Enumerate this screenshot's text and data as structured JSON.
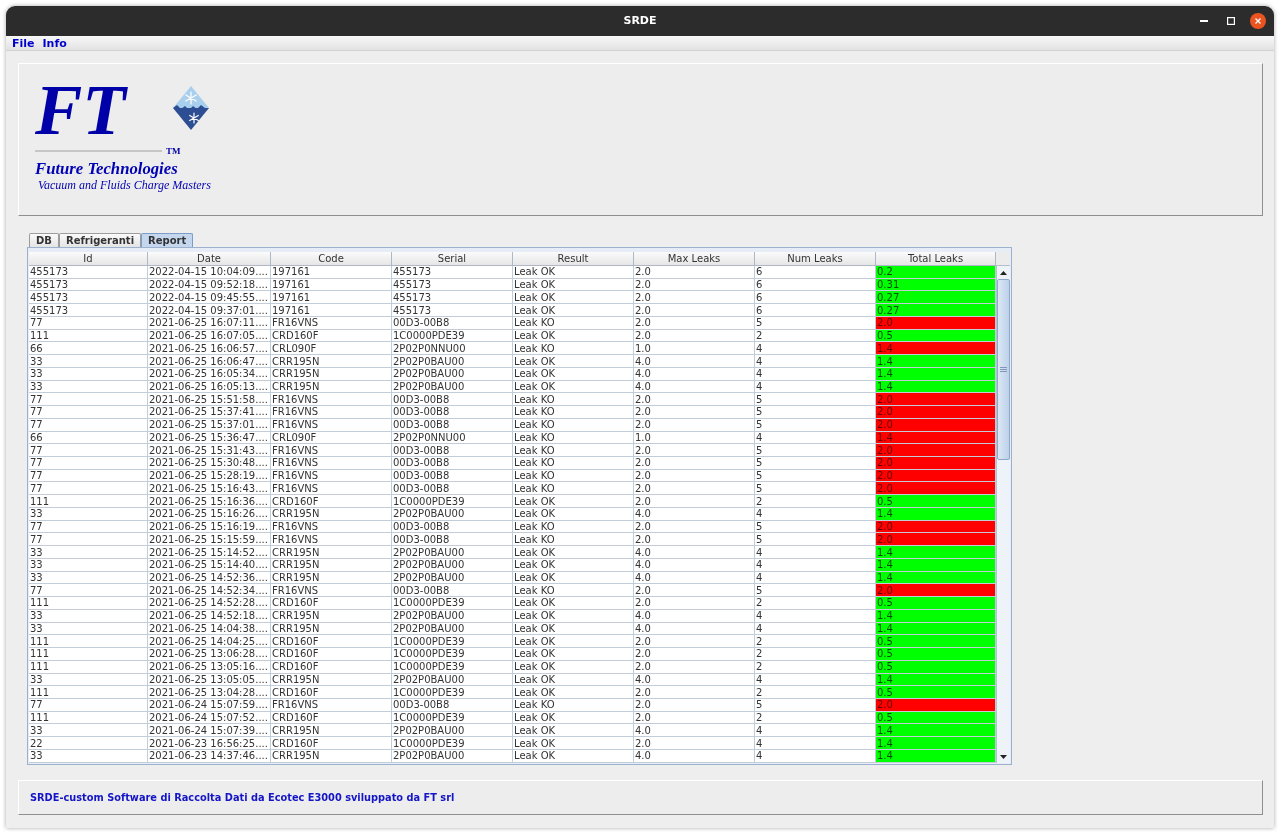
{
  "window": {
    "title": "SRDE"
  },
  "menu": [
    "File",
    "Info"
  ],
  "logo": {
    "mark": "FT",
    "trademark": "TM",
    "company": "Future Technologies",
    "tagline": "Vacuum and Fluids Charge Masters"
  },
  "tabs": [
    {
      "label": "DB",
      "selected": false
    },
    {
      "label": "Refrigeranti",
      "selected": false
    },
    {
      "label": "Report",
      "selected": true
    }
  ],
  "table": {
    "columns": [
      "Id",
      "Date",
      "Code",
      "Serial",
      "Result",
      "Max Leaks",
      "Num Leaks",
      "Total Leaks"
    ],
    "rows": [
      {
        "cells": [
          "455173",
          "2022-04-15 10:04:09....",
          "197161",
          "455173",
          "Leak OK",
          "2.0",
          "6",
          "0.2"
        ],
        "color": "#00ff00"
      },
      {
        "cells": [
          "455173",
          "2022-04-15 09:52:18....",
          "197161",
          "455173",
          "Leak OK",
          "2.0",
          "6",
          "0.31"
        ],
        "color": "#00ff00"
      },
      {
        "cells": [
          "455173",
          "2022-04-15 09:45:55....",
          "197161",
          "455173",
          "Leak OK",
          "2.0",
          "6",
          "0.27"
        ],
        "color": "#00ff00"
      },
      {
        "cells": [
          "455173",
          "2022-04-15 09:37:01....",
          "197161",
          "455173",
          "Leak OK",
          "2.0",
          "6",
          "0.27"
        ],
        "color": "#00ff00"
      },
      {
        "cells": [
          "77",
          "2021-06-25 16:07:11....",
          "FR16VNS",
          "00D3-00B8",
          "Leak KO",
          "2.0",
          "5",
          "2.0"
        ],
        "color": "#ff0000"
      },
      {
        "cells": [
          "111",
          "2021-06-25 16:07:05....",
          "CRD160F",
          "1C0000PDE39",
          "Leak OK",
          "2.0",
          "2",
          "0.5"
        ],
        "color": "#00ff00"
      },
      {
        "cells": [
          "66",
          "2021-06-25 16:06:57....",
          "CRL090F",
          "2P02P0NNU00",
          "Leak KO",
          "1.0",
          "4",
          "1.4"
        ],
        "color": "#ff0000"
      },
      {
        "cells": [
          "33",
          "2021-06-25 16:06:47....",
          "CRR195N",
          "2P02P0BAU00",
          "Leak OK",
          "4.0",
          "4",
          "1.4"
        ],
        "color": "#00ff00"
      },
      {
        "cells": [
          "33",
          "2021-06-25 16:05:34....",
          "CRR195N",
          "2P02P0BAU00",
          "Leak OK",
          "4.0",
          "4",
          "1.4"
        ],
        "color": "#00ff00"
      },
      {
        "cells": [
          "33",
          "2021-06-25 16:05:13....",
          "CRR195N",
          "2P02P0BAU00",
          "Leak OK",
          "4.0",
          "4",
          "1.4"
        ],
        "color": "#00ff00"
      },
      {
        "cells": [
          "77",
          "2021-06-25 15:51:58....",
          "FR16VNS",
          "00D3-00B8",
          "Leak KO",
          "2.0",
          "5",
          "2.0"
        ],
        "color": "#ff0000"
      },
      {
        "cells": [
          "77",
          "2021-06-25 15:37:41....",
          "FR16VNS",
          "00D3-00B8",
          "Leak KO",
          "2.0",
          "5",
          "2.0"
        ],
        "color": "#ff0000"
      },
      {
        "cells": [
          "77",
          "2021-06-25 15:37:01....",
          "FR16VNS",
          "00D3-00B8",
          "Leak KO",
          "2.0",
          "5",
          "2.0"
        ],
        "color": "#ff0000"
      },
      {
        "cells": [
          "66",
          "2021-06-25 15:36:47....",
          "CRL090F",
          "2P02P0NNU00",
          "Leak KO",
          "1.0",
          "4",
          "1.4"
        ],
        "color": "#ff0000"
      },
      {
        "cells": [
          "77",
          "2021-06-25 15:31:43....",
          "FR16VNS",
          "00D3-00B8",
          "Leak KO",
          "2.0",
          "5",
          "2.0"
        ],
        "color": "#ff0000"
      },
      {
        "cells": [
          "77",
          "2021-06-25 15:30:48....",
          "FR16VNS",
          "00D3-00B8",
          "Leak KO",
          "2.0",
          "5",
          "2.0"
        ],
        "color": "#ff0000"
      },
      {
        "cells": [
          "77",
          "2021-06-25 15:28:19....",
          "FR16VNS",
          "00D3-00B8",
          "Leak KO",
          "2.0",
          "5",
          "2.0"
        ],
        "color": "#ff0000"
      },
      {
        "cells": [
          "77",
          "2021-06-25 15:16:43....",
          "FR16VNS",
          "00D3-00B8",
          "Leak KO",
          "2.0",
          "5",
          "2.0"
        ],
        "color": "#ff0000"
      },
      {
        "cells": [
          "111",
          "2021-06-25 15:16:36....",
          "CRD160F",
          "1C0000PDE39",
          "Leak OK",
          "2.0",
          "2",
          "0.5"
        ],
        "color": "#00ff00"
      },
      {
        "cells": [
          "33",
          "2021-06-25 15:16:26....",
          "CRR195N",
          "2P02P0BAU00",
          "Leak OK",
          "4.0",
          "4",
          "1.4"
        ],
        "color": "#00ff00"
      },
      {
        "cells": [
          "77",
          "2021-06-25 15:16:19....",
          "FR16VNS",
          "00D3-00B8",
          "Leak KO",
          "2.0",
          "5",
          "2.0"
        ],
        "color": "#ff0000"
      },
      {
        "cells": [
          "77",
          "2021-06-25 15:15:59....",
          "FR16VNS",
          "00D3-00B8",
          "Leak KO",
          "2.0",
          "5",
          "2.0"
        ],
        "color": "#ff0000"
      },
      {
        "cells": [
          "33",
          "2021-06-25 15:14:52....",
          "CRR195N",
          "2P02P0BAU00",
          "Leak OK",
          "4.0",
          "4",
          "1.4"
        ],
        "color": "#00ff00"
      },
      {
        "cells": [
          "33",
          "2021-06-25 15:14:40....",
          "CRR195N",
          "2P02P0BAU00",
          "Leak OK",
          "4.0",
          "4",
          "1.4"
        ],
        "color": "#00ff00"
      },
      {
        "cells": [
          "33",
          "2021-06-25 14:52:36....",
          "CRR195N",
          "2P02P0BAU00",
          "Leak OK",
          "4.0",
          "4",
          "1.4"
        ],
        "color": "#00ff00"
      },
      {
        "cells": [
          "77",
          "2021-06-25 14:52:34....",
          "FR16VNS",
          "00D3-00B8",
          "Leak KO",
          "2.0",
          "5",
          "2.0"
        ],
        "color": "#ff0000"
      },
      {
        "cells": [
          "111",
          "2021-06-25 14:52:28....",
          "CRD160F",
          "1C0000PDE39",
          "Leak OK",
          "2.0",
          "2",
          "0.5"
        ],
        "color": "#00ff00"
      },
      {
        "cells": [
          "33",
          "2021-06-25 14:52:18....",
          "CRR195N",
          "2P02P0BAU00",
          "Leak OK",
          "4.0",
          "4",
          "1.4"
        ],
        "color": "#00ff00"
      },
      {
        "cells": [
          "33",
          "2021-06-25 14:04:38....",
          "CRR195N",
          "2P02P0BAU00",
          "Leak OK",
          "4.0",
          "4",
          "1.4"
        ],
        "color": "#00ff00"
      },
      {
        "cells": [
          "111",
          "2021-06-25 14:04:25....",
          "CRD160F",
          "1C0000PDE39",
          "Leak OK",
          "2.0",
          "2",
          "0.5"
        ],
        "color": "#00ff00"
      },
      {
        "cells": [
          "111",
          "2021-06-25 13:06:28....",
          "CRD160F",
          "1C0000PDE39",
          "Leak OK",
          "2.0",
          "2",
          "0.5"
        ],
        "color": "#00ff00"
      },
      {
        "cells": [
          "111",
          "2021-06-25 13:05:16....",
          "CRD160F",
          "1C0000PDE39",
          "Leak OK",
          "2.0",
          "2",
          "0.5"
        ],
        "color": "#00ff00"
      },
      {
        "cells": [
          "33",
          "2021-06-25 13:05:05....",
          "CRR195N",
          "2P02P0BAU00",
          "Leak OK",
          "4.0",
          "4",
          "1.4"
        ],
        "color": "#00ff00"
      },
      {
        "cells": [
          "111",
          "2021-06-25 13:04:28....",
          "CRD160F",
          "1C0000PDE39",
          "Leak OK",
          "2.0",
          "2",
          "0.5"
        ],
        "color": "#00ff00"
      },
      {
        "cells": [
          "77",
          "2021-06-24 15:07:59....",
          "FR16VNS",
          "00D3-00B8",
          "Leak KO",
          "2.0",
          "5",
          "2.0"
        ],
        "color": "#ff0000"
      },
      {
        "cells": [
          "111",
          "2021-06-24 15:07:52....",
          "CRD160F",
          "1C0000PDE39",
          "Leak OK",
          "2.0",
          "2",
          "0.5"
        ],
        "color": "#00ff00"
      },
      {
        "cells": [
          "33",
          "2021-06-24 15:07:39....",
          "CRR195N",
          "2P02P0BAU00",
          "Leak OK",
          "4.0",
          "4",
          "1.4"
        ],
        "color": "#00ff00"
      },
      {
        "cells": [
          "22",
          "2021-06-23 16:56:25....",
          "CRD160F",
          "1C0000PDE39",
          "Leak OK",
          "2.0",
          "4",
          "1.4"
        ],
        "color": "#00ff00"
      },
      {
        "cells": [
          "33",
          "2021-06-23 14:37:46....",
          "CRR195N",
          "2P02P0BAU00",
          "Leak OK",
          "4.0",
          "4",
          "1.4"
        ],
        "color": "#00ff00"
      }
    ]
  },
  "status_bar": {
    "text": "SRDE-custom Software di Raccolta Dati da Ecotec E3000 sviluppato da FT srl"
  }
}
